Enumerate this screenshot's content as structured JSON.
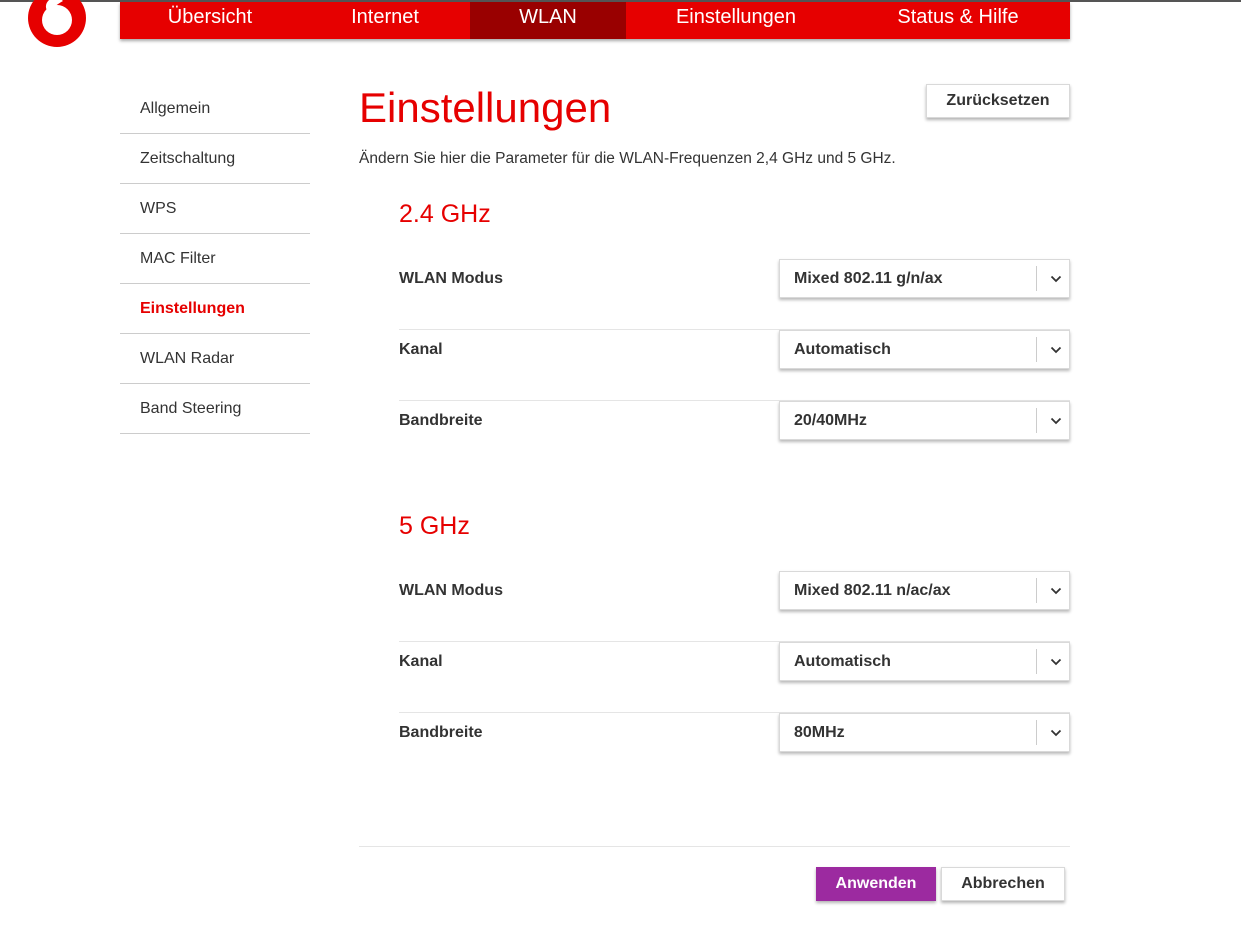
{
  "header": {
    "nav": [
      {
        "label": "Übersicht"
      },
      {
        "label": "Internet"
      },
      {
        "label": "WLAN",
        "active": true
      },
      {
        "label": "Einstellungen"
      },
      {
        "label": "Status & Hilfe"
      }
    ]
  },
  "sidebar": {
    "items": [
      {
        "label": "Allgemein"
      },
      {
        "label": "Zeitschaltung"
      },
      {
        "label": "WPS"
      },
      {
        "label": "MAC Filter"
      },
      {
        "label": "Einstellungen",
        "active": true
      },
      {
        "label": "WLAN Radar"
      },
      {
        "label": "Band Steering"
      }
    ]
  },
  "main": {
    "title": "Einstellungen",
    "reset_label": "Zurücksetzen",
    "intro": "Ändern Sie hier die Parameter für die WLAN-Frequenzen 2,4 GHz und 5 GHz.",
    "band24": {
      "title": "2.4 GHz",
      "mode_label": "WLAN Modus",
      "mode_value": "Mixed 802.11 g/n/ax",
      "channel_label": "Kanal",
      "channel_value": "Automatisch",
      "bandwidth_label": "Bandbreite",
      "bandwidth_value": "20/40MHz"
    },
    "band5": {
      "title": "5 GHz",
      "mode_label": "WLAN Modus",
      "mode_value": "Mixed 802.11 n/ac/ax",
      "channel_label": "Kanal",
      "channel_value": "Automatisch",
      "bandwidth_label": "Bandbreite",
      "bandwidth_value": "80MHz"
    },
    "apply_label": "Anwenden",
    "cancel_label": "Abbrechen"
  },
  "colors": {
    "brand_red": "#e60000",
    "nav_active": "#990000",
    "apply_purple": "#9c2aa0"
  },
  "icons": {
    "logo": "vodafone-logo",
    "select_arrow": "chevron-down-icon"
  }
}
